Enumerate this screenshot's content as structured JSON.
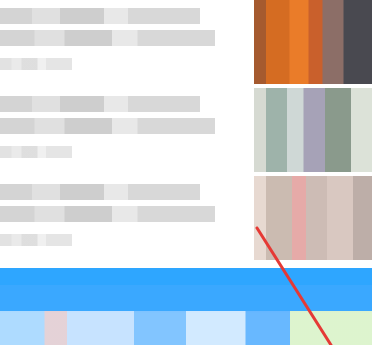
{
  "feed": {
    "items": [
      {
        "thumbnail_icon": "image-thumbnail-icon"
      },
      {
        "thumbnail_icon": "image-thumbnail-icon"
      },
      {
        "thumbnail_icon": "image-thumbnail-icon"
      }
    ]
  },
  "colors": {
    "bottom_bar": "#2ea6ff",
    "pointer": "#e53935"
  }
}
